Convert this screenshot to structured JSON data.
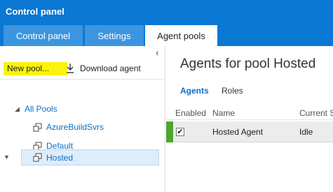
{
  "app": {
    "title": "Control panel"
  },
  "tabs": [
    {
      "label": "Control panel"
    },
    {
      "label": "Settings"
    },
    {
      "label": "Agent pools",
      "active": true
    }
  ],
  "left": {
    "collapse_icon": "chevron-left-icon",
    "toolbar": {
      "new_pool_label": "New pool...",
      "download_label": "Download agent",
      "download_icon": "download-icon",
      "highlight_color": "#fbf30a"
    },
    "tree": {
      "root_label": "All Pools",
      "pools": [
        {
          "label": "AzureBuildSvrs",
          "icon": "agent-pool-icon"
        },
        {
          "label": "Default",
          "icon": "agent-pool-icon"
        },
        {
          "label": "Hosted",
          "icon": "agent-pool-icon",
          "selected": true
        }
      ]
    }
  },
  "right": {
    "title": "Agents for pool Hosted",
    "subtabs": [
      {
        "label": "Agents",
        "active": true
      },
      {
        "label": "Roles"
      }
    ],
    "columns": {
      "enabled": "Enabled",
      "name": "Name",
      "status": "Current S"
    },
    "agents": [
      {
        "name": "Hosted Agent",
        "status": "Idle",
        "enabled": true,
        "status_color": "#4ca52f"
      }
    ]
  },
  "colors": {
    "brand": "#0b78d4",
    "tab": "#3c95e0",
    "link": "#0b6fc7"
  }
}
